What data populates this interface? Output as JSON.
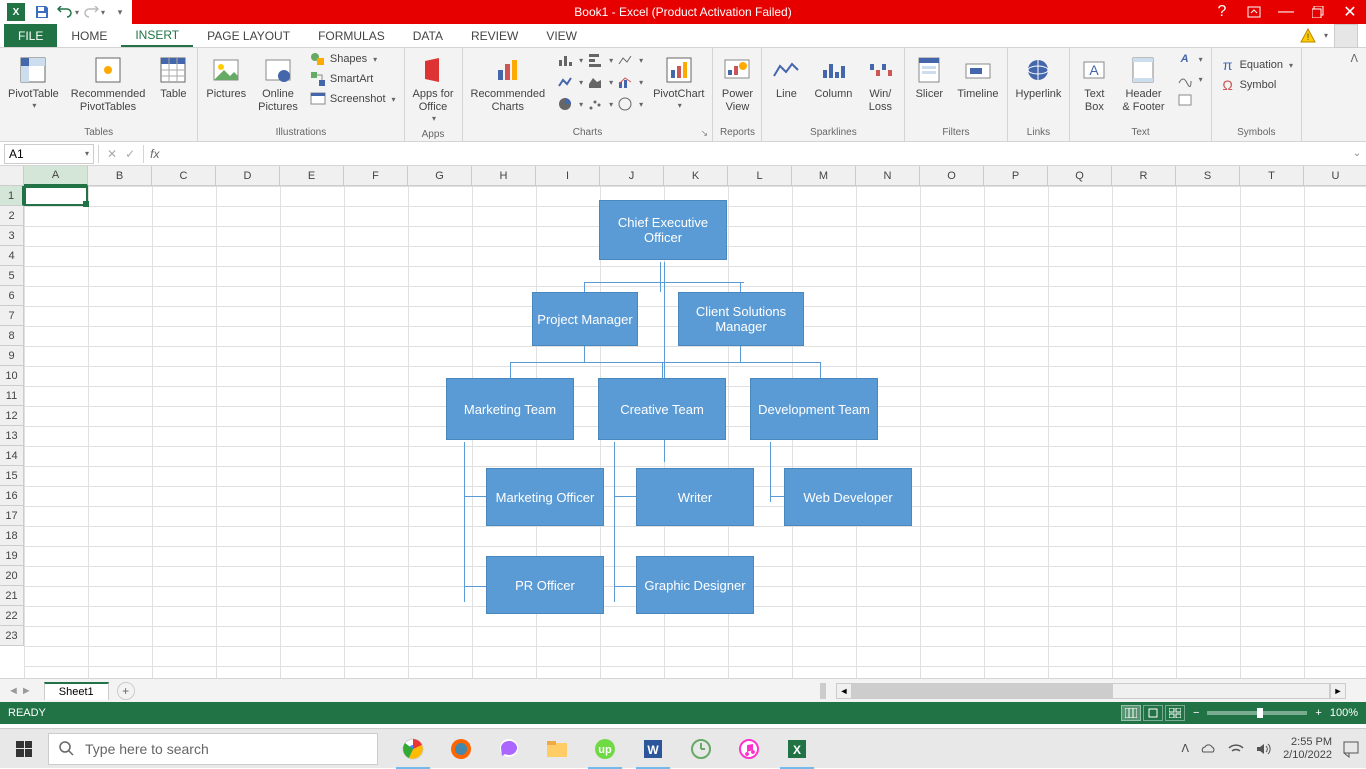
{
  "titlebar": {
    "title": "Book1 - Excel (Product Activation Failed)"
  },
  "tabs": {
    "file": "FILE",
    "home": "HOME",
    "insert": "INSERT",
    "pagelayout": "PAGE LAYOUT",
    "formulas": "FORMULAS",
    "data": "DATA",
    "review": "REVIEW",
    "view": "VIEW"
  },
  "ribbon": {
    "tables": {
      "pivot": "PivotTable",
      "recpivot": "Recommended\nPivotTables",
      "table": "Table",
      "group": "Tables"
    },
    "illus": {
      "pictures": "Pictures",
      "online": "Online\nPictures",
      "shapes": "Shapes",
      "smartart": "SmartArt",
      "screenshot": "Screenshot",
      "group": "Illustrations"
    },
    "apps": {
      "apps": "Apps for\nOffice",
      "group": "Apps"
    },
    "charts": {
      "rec": "Recommended\nCharts",
      "pivotchart": "PivotChart",
      "group": "Charts"
    },
    "reports": {
      "powerview": "Power\nView",
      "group": "Reports"
    },
    "spark": {
      "line": "Line",
      "column": "Column",
      "winloss": "Win/\nLoss",
      "group": "Sparklines"
    },
    "filters": {
      "slicer": "Slicer",
      "timeline": "Timeline",
      "group": "Filters"
    },
    "links": {
      "hyperlink": "Hyperlink",
      "group": "Links"
    },
    "text": {
      "textbox": "Text\nBox",
      "headerfooter": "Header\n& Footer",
      "group": "Text"
    },
    "symbols": {
      "equation": "Equation",
      "symbol": "Symbol",
      "group": "Symbols"
    }
  },
  "formula": {
    "namebox": "A1"
  },
  "columns": [
    "A",
    "B",
    "C",
    "D",
    "E",
    "F",
    "G",
    "H",
    "I",
    "J",
    "K",
    "L",
    "M",
    "N",
    "O",
    "P",
    "Q",
    "R",
    "S",
    "T",
    "U"
  ],
  "rows": [
    "1",
    "2",
    "3",
    "4",
    "5",
    "6",
    "7",
    "8",
    "9",
    "10",
    "11",
    "12",
    "13",
    "14",
    "15",
    "16",
    "17",
    "18",
    "19",
    "20",
    "21",
    "22",
    "23"
  ],
  "org": {
    "ceo": "Chief Executive Officer",
    "pm": "Project Manager",
    "csm": "Client Solutions Manager",
    "mktteam": "Marketing Team",
    "creteam": "Creative Team",
    "devteam": "Development Team",
    "mktoff": "Marketing Officer",
    "writer": "Writer",
    "webdev": "Web Developer",
    "proff": "PR Officer",
    "gd": "Graphic Designer"
  },
  "chart_data": {
    "type": "org-hierarchy",
    "title": "",
    "nodes": [
      {
        "id": "ceo",
        "label": "Chief Executive Officer",
        "parent": null
      },
      {
        "id": "pm",
        "label": "Project Manager",
        "parent": "ceo"
      },
      {
        "id": "csm",
        "label": "Client Solutions Manager",
        "parent": "ceo"
      },
      {
        "id": "mktteam",
        "label": "Marketing Team",
        "parent": "pm"
      },
      {
        "id": "creteam",
        "label": "Creative Team",
        "parent": "pm"
      },
      {
        "id": "devteam",
        "label": "Development Team",
        "parent": "csm"
      },
      {
        "id": "mktoff",
        "label": "Marketing Officer",
        "parent": "mktteam"
      },
      {
        "id": "proff",
        "label": "PR Officer",
        "parent": "mktteam"
      },
      {
        "id": "writer",
        "label": "Writer",
        "parent": "creteam"
      },
      {
        "id": "gd",
        "label": "Graphic Designer",
        "parent": "creteam"
      },
      {
        "id": "webdev",
        "label": "Web Developer",
        "parent": "devteam"
      }
    ]
  },
  "sheets": {
    "active": "Sheet1"
  },
  "status": {
    "ready": "READY",
    "zoom": "100%"
  },
  "taskbar": {
    "search": "Type here to search",
    "time": "2:55 PM",
    "date": "2/10/2022"
  }
}
